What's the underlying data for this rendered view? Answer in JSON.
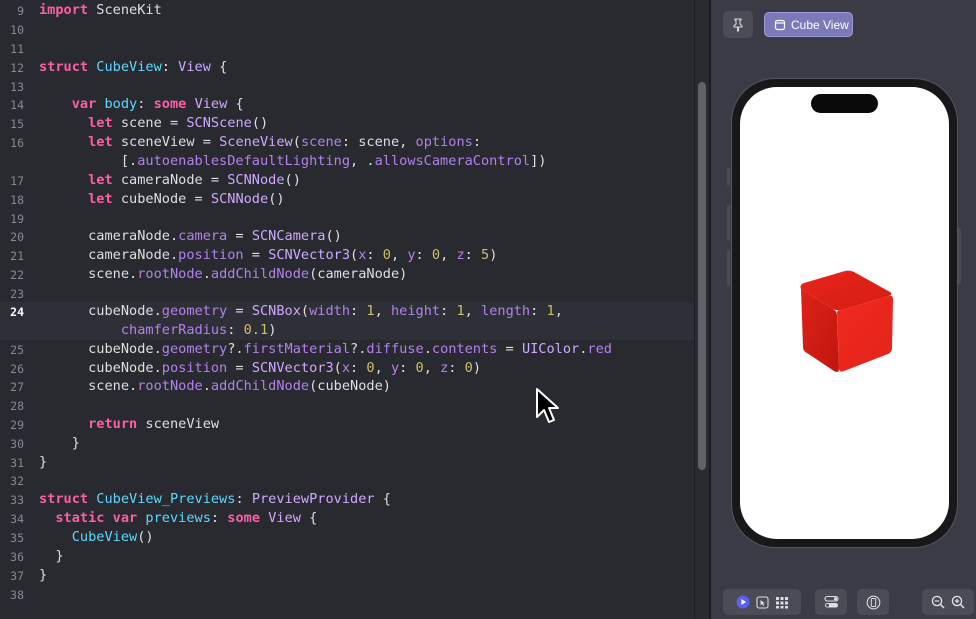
{
  "editor": {
    "current_line": "24",
    "lines": [
      {
        "n": "9"
      },
      {
        "n": "10"
      },
      {
        "n": "11"
      },
      {
        "n": "12"
      },
      {
        "n": "13"
      },
      {
        "n": "14"
      },
      {
        "n": "15"
      },
      {
        "n": "16"
      },
      {
        "n": "17"
      },
      {
        "n": "18"
      },
      {
        "n": "19"
      },
      {
        "n": "20"
      },
      {
        "n": "21"
      },
      {
        "n": "22"
      },
      {
        "n": "23"
      },
      {
        "n": "24"
      },
      {
        "n": "25"
      },
      {
        "n": "26"
      },
      {
        "n": "27"
      },
      {
        "n": "28"
      },
      {
        "n": "29"
      },
      {
        "n": "30"
      },
      {
        "n": "31"
      },
      {
        "n": "32"
      },
      {
        "n": "33"
      },
      {
        "n": "34"
      },
      {
        "n": "35"
      },
      {
        "n": "36"
      },
      {
        "n": "37"
      },
      {
        "n": "38"
      }
    ]
  },
  "preview": {
    "pin_icon": "pin-icon",
    "tab_label": "Cube View",
    "tab_icon": "device-icon",
    "cube_color": "#e2231a"
  },
  "toolbar": {
    "live_icon": "play-circle-icon",
    "select_icon": "cursor-select-icon",
    "grid_icon": "grid-icon",
    "variants_icon": "toggles-icon",
    "device_settings_icon": "device-settings-icon",
    "zoom_out_icon": "zoom-out-icon",
    "zoom_in_icon": "zoom-in-icon"
  },
  "colors": {
    "keyword": "#fc5fa3",
    "type": "#5dd8ff",
    "other_type": "#d0a8ff",
    "property": "#b281eb",
    "number": "#d0bf69",
    "accent": "#7c79b8"
  }
}
